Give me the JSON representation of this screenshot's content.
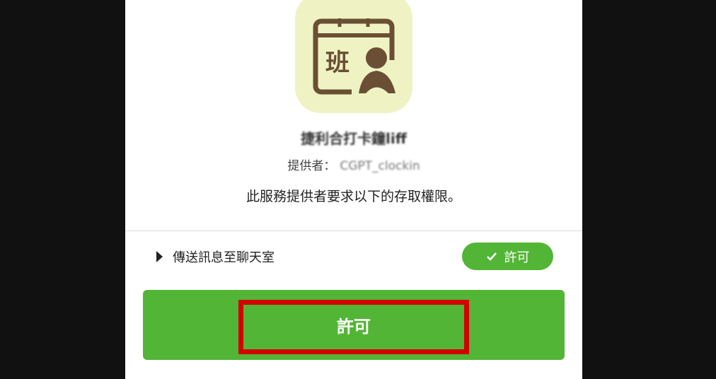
{
  "app": {
    "name": "捷利合打卡鐘liff",
    "provider_label": "提供者：",
    "provider_name": "CGPT_clockin",
    "icon": "calendar-shift-person-icon",
    "icon_glyph": "班"
  },
  "description": "此服務提供者要求以下的存取權限。",
  "permissions": [
    {
      "label": "傳送訊息至聊天室",
      "status": "許可",
      "status_icon": "check-icon"
    }
  ],
  "allow_button": "許可",
  "colors": {
    "accent": "#52b535",
    "highlight": "#d40000",
    "icon_bg": "#eff3c4",
    "icon_fg": "#6b4f34"
  }
}
